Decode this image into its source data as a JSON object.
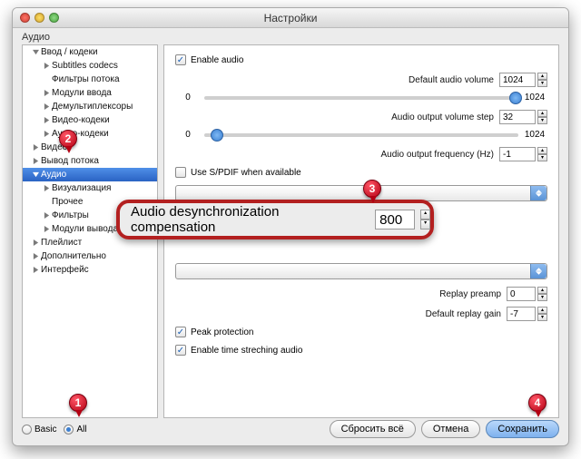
{
  "window": {
    "title": "Настройки"
  },
  "section": "Аудио",
  "sidebar": {
    "items": [
      {
        "label": "Ввод / кодеки",
        "depth": 0,
        "arrow": "down"
      },
      {
        "label": "Subtitles codecs",
        "depth": 1,
        "arrow": "right"
      },
      {
        "label": "Фильтры потока",
        "depth": 1,
        "arrow": ""
      },
      {
        "label": "Модули ввода",
        "depth": 1,
        "arrow": "right"
      },
      {
        "label": "Демультиплексоры",
        "depth": 1,
        "arrow": "right"
      },
      {
        "label": "Видео-кодеки",
        "depth": 1,
        "arrow": "right"
      },
      {
        "label": "Аудио-кодеки",
        "depth": 1,
        "arrow": "right"
      },
      {
        "label": "Видео",
        "depth": 0,
        "arrow": "right"
      },
      {
        "label": "Вывод потока",
        "depth": 0,
        "arrow": "right"
      },
      {
        "label": "Аудио",
        "depth": 0,
        "arrow": "down",
        "selected": true
      },
      {
        "label": "Визуализация",
        "depth": 1,
        "arrow": "right"
      },
      {
        "label": "Прочее",
        "depth": 1,
        "arrow": ""
      },
      {
        "label": "Фильтры",
        "depth": 1,
        "arrow": "right"
      },
      {
        "label": "Модули вывода",
        "depth": 1,
        "arrow": "right"
      },
      {
        "label": "Плейлист",
        "depth": 0,
        "arrow": "right"
      },
      {
        "label": "Дополнительно",
        "depth": 0,
        "arrow": "right"
      },
      {
        "label": "Интерфейс",
        "depth": 0,
        "arrow": "right"
      }
    ]
  },
  "panel": {
    "enable_audio": {
      "label": "Enable audio",
      "checked": true
    },
    "default_volume": {
      "label": "Default audio volume",
      "value": "1024"
    },
    "volume_slider": {
      "min": "0",
      "max": "1024",
      "pos": 100
    },
    "output_step": {
      "label": "Audio output volume step",
      "value": "32"
    },
    "step_slider": {
      "min": "0",
      "max": "1024",
      "pos": 4
    },
    "output_freq": {
      "label": "Audio output frequency (Hz)",
      "value": "-1"
    },
    "use_spdif": {
      "label": "Use S/PDIF when available",
      "checked": false
    },
    "desync": {
      "label": "Audio desynchronization compensation",
      "value": "800"
    },
    "replay_preamp": {
      "label": "Replay preamp",
      "value": "0"
    },
    "default_replay_gain": {
      "label": "Default replay gain",
      "value": "-7"
    },
    "peak_protection": {
      "label": "Peak protection",
      "checked": true
    },
    "time_stretch": {
      "label": "Enable time streching audio",
      "checked": true
    }
  },
  "footer": {
    "basic": "Basic",
    "all": "All",
    "reset": "Сбросить всё",
    "cancel": "Отмена",
    "save": "Сохранить"
  },
  "badges": {
    "b1": "1",
    "b2": "2",
    "b3": "3",
    "b4": "4"
  }
}
